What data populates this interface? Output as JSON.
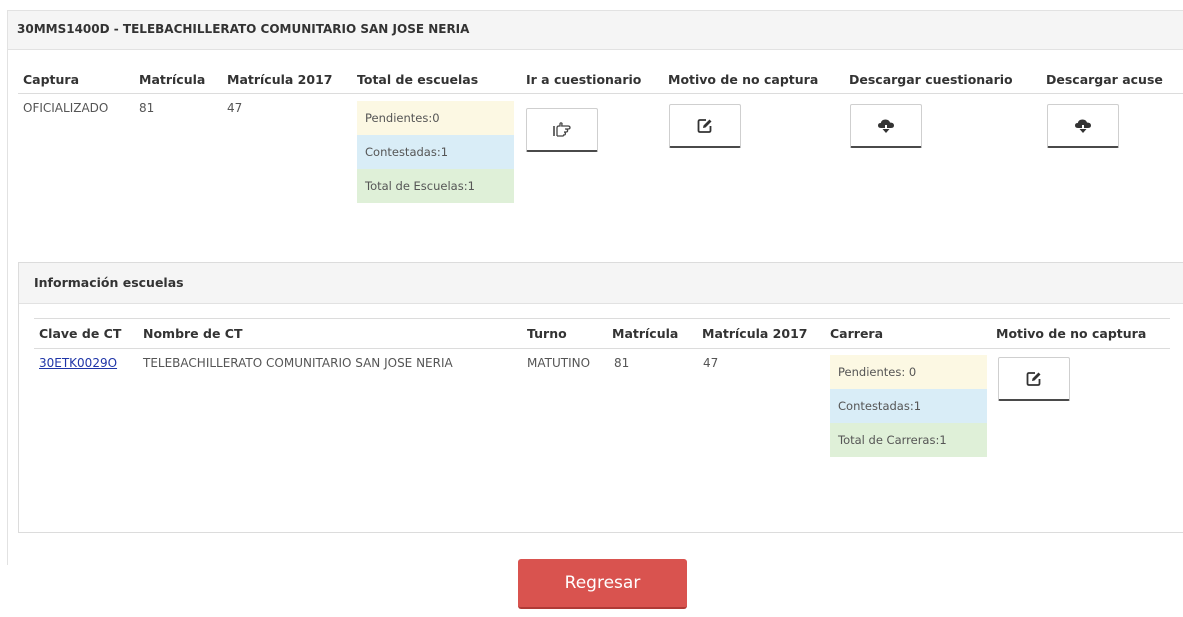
{
  "panel": {
    "title": "30MMS1400D - TELEBACHILLERATO COMUNITARIO SAN JOSE NERIA"
  },
  "summary_table": {
    "headers": [
      "Captura",
      "Matrícula",
      "Matrícula 2017",
      "Total de escuelas",
      "Ir a cuestionario",
      "Motivo de no captura",
      "Descargar cuestionario",
      "Descargar acuse"
    ],
    "row": {
      "captura": "OFICIALIZADO",
      "matricula": "81",
      "matricula_2017": "47",
      "totals": [
        "Pendientes:0",
        "Contestadas:1",
        "Total de Escuelas:1"
      ]
    },
    "icons": {
      "ir_cuestionario": "pointing-hand-icon",
      "motivo": "edit-icon",
      "descargar_cuestionario": "cloud-download-icon",
      "descargar_acuse": "cloud-download-icon"
    }
  },
  "schools": {
    "title": "Información escuelas",
    "headers": [
      "Clave de CT",
      "Nombre de CT",
      "Turno",
      "Matrícula",
      "Matrícula 2017",
      "Carrera",
      "Motivo de no captura"
    ],
    "row": {
      "clave": "30ETK0029O",
      "nombre": "TELEBACHILLERATO COMUNITARIO SAN JOSE NERIA",
      "turno": "MATUTINO",
      "matricula": "81",
      "matricula_2017": "47",
      "carrera": [
        "Pendientes: 0",
        "Contestadas:1",
        "Total de Carreras:1"
      ]
    }
  },
  "footer": {
    "back_label": "Regresar"
  },
  "colors": {
    "pending": "#fcf8e3",
    "answered": "#d9edf7",
    "total": "#dff0d8",
    "back_button": "#d9534f",
    "link": "#1f35a8"
  }
}
